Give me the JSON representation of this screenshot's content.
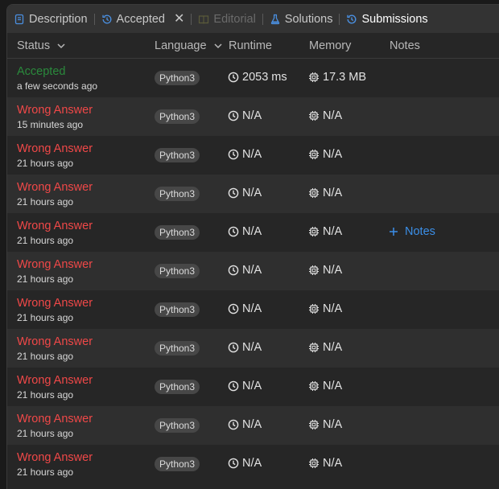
{
  "tabs": [
    {
      "label": "Description"
    },
    {
      "label": "Accepted"
    },
    {
      "label": "Editorial"
    },
    {
      "label": "Solutions"
    },
    {
      "label": "Submissions"
    }
  ],
  "table": {
    "headers": {
      "status": "Status",
      "language": "Language",
      "runtime": "Runtime",
      "memory": "Memory",
      "notes": "Notes"
    },
    "rows": [
      {
        "status": "Accepted",
        "time": "a few seconds ago",
        "lang": "Python3",
        "runtime": "2053 ms",
        "memory": "17.3 MB"
      },
      {
        "status": "Wrong Answer",
        "time": "15 minutes ago",
        "lang": "Python3",
        "runtime": "N/A",
        "memory": "N/A"
      },
      {
        "status": "Wrong Answer",
        "time": "21 hours ago",
        "lang": "Python3",
        "runtime": "N/A",
        "memory": "N/A"
      },
      {
        "status": "Wrong Answer",
        "time": "21 hours ago",
        "lang": "Python3",
        "runtime": "N/A",
        "memory": "N/A"
      },
      {
        "status": "Wrong Answer",
        "time": "21 hours ago",
        "lang": "Python3",
        "runtime": "N/A",
        "memory": "N/A",
        "notes": "Notes"
      },
      {
        "status": "Wrong Answer",
        "time": "21 hours ago",
        "lang": "Python3",
        "runtime": "N/A",
        "memory": "N/A"
      },
      {
        "status": "Wrong Answer",
        "time": "21 hours ago",
        "lang": "Python3",
        "runtime": "N/A",
        "memory": "N/A"
      },
      {
        "status": "Wrong Answer",
        "time": "21 hours ago",
        "lang": "Python3",
        "runtime": "N/A",
        "memory": "N/A"
      },
      {
        "status": "Wrong Answer",
        "time": "21 hours ago",
        "lang": "Python3",
        "runtime": "N/A",
        "memory": "N/A"
      },
      {
        "status": "Wrong Answer",
        "time": "21 hours ago",
        "lang": "Python3",
        "runtime": "N/A",
        "memory": "N/A"
      },
      {
        "status": "Wrong Answer",
        "time": "21 hours ago",
        "lang": "Python3",
        "runtime": "N/A",
        "memory": "N/A"
      }
    ]
  },
  "colors": {
    "accepted": "#2a8a3c",
    "wrong": "#f04848",
    "accent": "#3b8fe8"
  },
  "icons": {
    "description": "description-icon",
    "accepted": "history-icon",
    "editorial": "book-icon",
    "solutions": "flask-icon",
    "submissions": "history-icon",
    "runtime": "clock-icon",
    "memory": "chip-icon"
  }
}
